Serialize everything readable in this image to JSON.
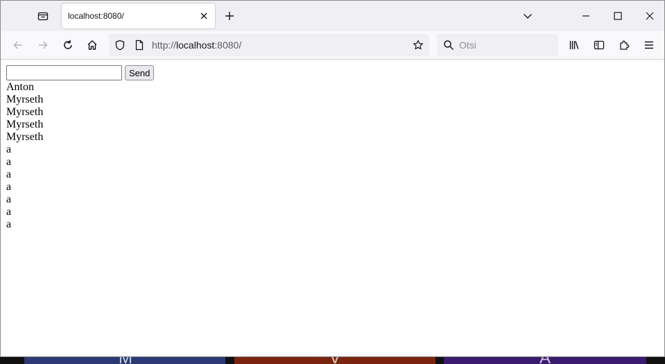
{
  "browser": {
    "tab_title": "localhost:8080/",
    "url": {
      "scheme": "http://",
      "host": "localhost",
      "rest": ":8080/"
    },
    "search_placeholder": "Otsi",
    "icons": [
      "tab-overview-icon",
      "close-icon",
      "plus-icon",
      "chevron-down-icon",
      "minimize-icon",
      "maximize-icon",
      "window-close-icon",
      "back-arrow-icon",
      "forward-arrow-icon",
      "reload-icon",
      "home-icon",
      "shield-icon",
      "page-icon",
      "star-icon",
      "search-icon",
      "library-icon",
      "sidebar-icon",
      "extensions-icon",
      "menu-icon"
    ]
  },
  "page": {
    "input_value": "",
    "send_label": "Send",
    "messages": [
      "Anton",
      "Myrseth",
      "Myrseth",
      "Myrseth",
      "Myrseth",
      "a",
      "a",
      "a",
      "a",
      "a",
      "a",
      "a"
    ]
  },
  "taskbar": {
    "items": [
      {
        "letter": "M",
        "color": "#2b3a77"
      },
      {
        "letter": "V",
        "color": "#7a2410"
      },
      {
        "letter": "A",
        "color": "#3a1a6e"
      }
    ]
  }
}
